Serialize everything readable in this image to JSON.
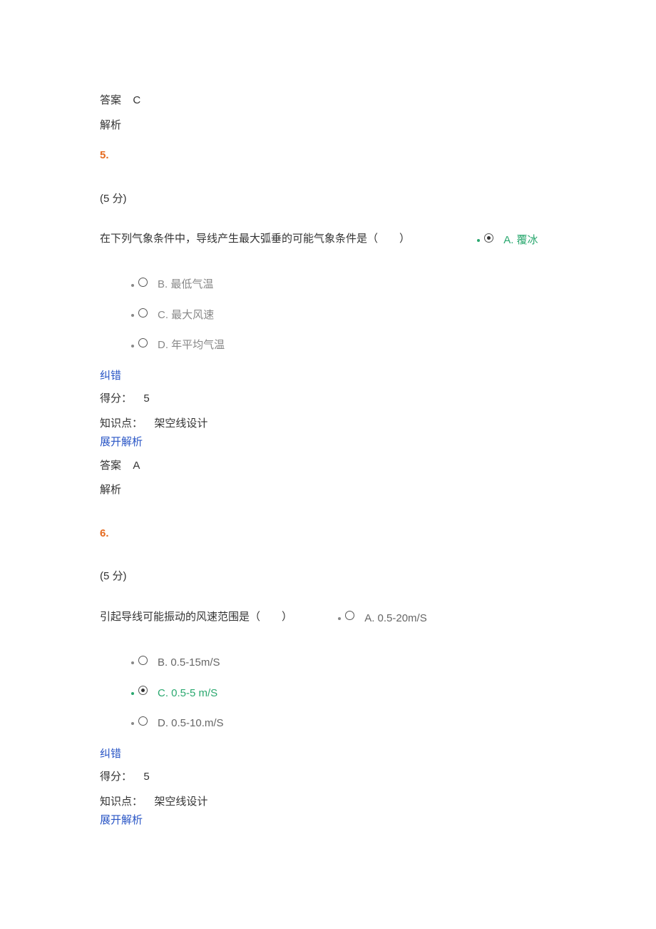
{
  "labels": {
    "answer": "答案",
    "explain": "解析",
    "score": "得分：",
    "kp": "知识点：",
    "expand": "展开解析",
    "correction": "纠错"
  },
  "prev_block": {
    "answer_value": "C",
    "explain_value": ""
  },
  "q5": {
    "number": "5.",
    "points": "(5 分)",
    "stem": "在下列气象条件中，导线产生最大弧垂的可能气象条件是（　　）",
    "options": [
      {
        "key": "A",
        "label": "A. 覆冰",
        "selected": true
      },
      {
        "key": "B",
        "label": "B. 最低气温",
        "selected": false
      },
      {
        "key": "C",
        "label": "C. 最大风速",
        "selected": false
      },
      {
        "key": "D",
        "label": "D. 年平均气温",
        "selected": false
      }
    ],
    "score_value": "5",
    "kp_value": "架空线设计",
    "answer_value": "A",
    "explain_value": ""
  },
  "q6": {
    "number": "6.",
    "points": "(5 分)",
    "stem": "引起导线可能振动的风速范围是（　　）",
    "options": [
      {
        "key": "A",
        "label": "A. 0.5-20m/S",
        "selected": false
      },
      {
        "key": "B",
        "label": "B. 0.5-15m/S",
        "selected": false
      },
      {
        "key": "C",
        "label": "C. 0.5-5 m/S",
        "selected": true
      },
      {
        "key": "D",
        "label": "D. 0.5-10.m/S",
        "selected": false
      }
    ],
    "score_value": "5",
    "kp_value": "架空线设计"
  }
}
